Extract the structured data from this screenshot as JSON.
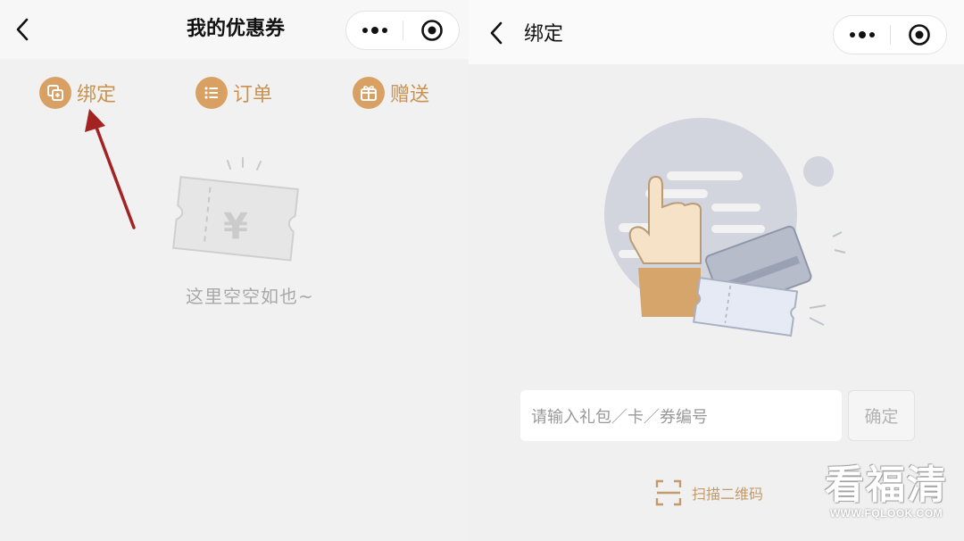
{
  "left": {
    "nav": {
      "title": "我的优惠券"
    },
    "tabs": [
      {
        "label": "绑定",
        "icon": "bind-card-icon"
      },
      {
        "label": "订单",
        "icon": "list-icon"
      },
      {
        "label": "赠送",
        "icon": "gift-icon"
      }
    ],
    "empty_text": "这里空空如也~",
    "ticket_symbol": "¥"
  },
  "right": {
    "nav": {
      "title": "绑定"
    },
    "input": {
      "placeholder": "请输入礼包／卡／券编号"
    },
    "confirm_label": "确定",
    "scan_label": "扫描二维码"
  },
  "watermark": {
    "big": "看福清",
    "small": "WWW.FQLOOK.COM"
  },
  "colors": {
    "accent": "#d9a064",
    "accent_text": "#c9924f",
    "annotation_arrow": "#a32222"
  }
}
